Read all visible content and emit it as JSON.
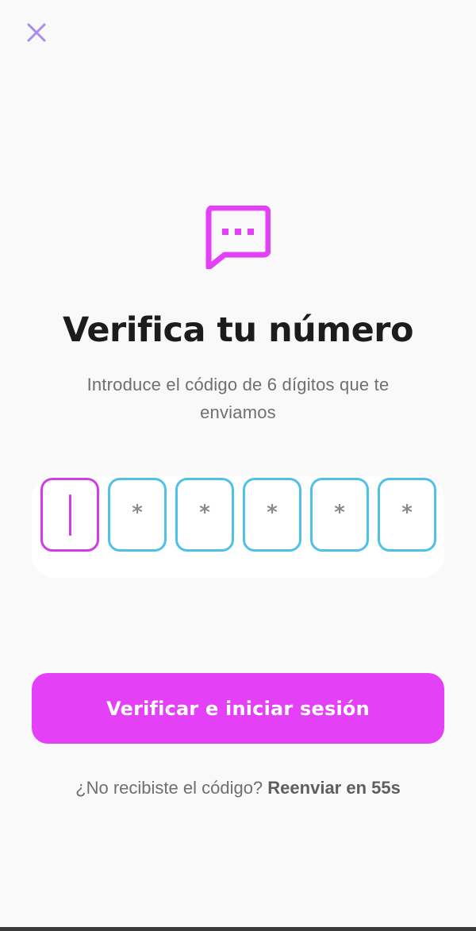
{
  "header": {
    "close_icon": "close-icon"
  },
  "hero": {
    "icon": "chat-bubble-dots-icon",
    "title": "Verifica tu número",
    "subtitle": "Introduce el código de 6 dígitos que te enviamos"
  },
  "code_input": {
    "length": 6,
    "active_index": 0,
    "placeholder": "*",
    "boxes": [
      "",
      "*",
      "*",
      "*",
      "*",
      "*"
    ]
  },
  "actions": {
    "verify_label": "Verificar e iniciar sesión",
    "resend_prompt": "¿No recibiste el código?",
    "resend_label": "Reenviar en 55s"
  },
  "colors": {
    "accent": "#e340f7",
    "active_border": "#d23ce8",
    "inactive_border": "#4dc2e6",
    "close_icon": "#a78bf0",
    "background": "#f9f9f9"
  }
}
